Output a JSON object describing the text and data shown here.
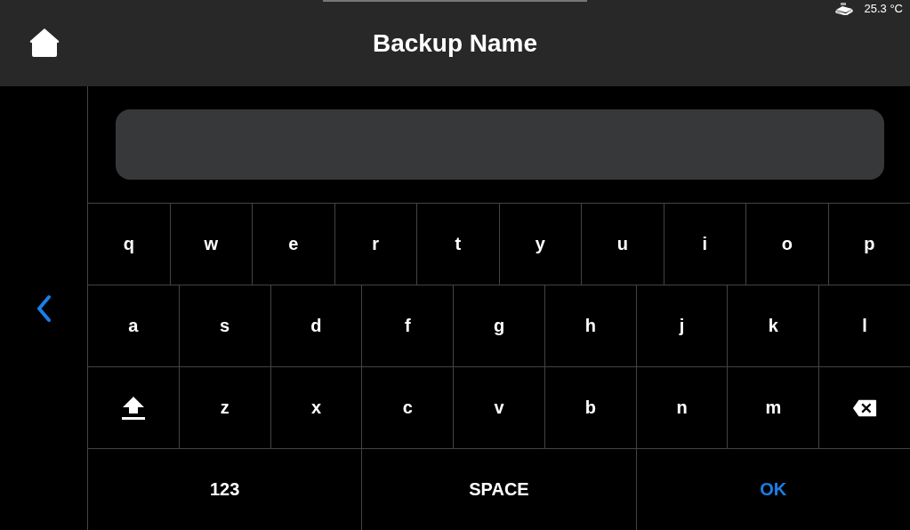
{
  "status_bar": {
    "temperature": "25.3 °C"
  },
  "header": {
    "title": "Backup Name"
  },
  "keyboard": {
    "rows": [
      {
        "keys": [
          {
            "kind": "char",
            "label": "q"
          },
          {
            "kind": "char",
            "label": "w"
          },
          {
            "kind": "char",
            "label": "e"
          },
          {
            "kind": "char",
            "label": "r"
          },
          {
            "kind": "char",
            "label": "t"
          },
          {
            "kind": "char",
            "label": "y"
          },
          {
            "kind": "char",
            "label": "u"
          },
          {
            "kind": "char",
            "label": "i"
          },
          {
            "kind": "char",
            "label": "o"
          },
          {
            "kind": "char",
            "label": "p"
          }
        ]
      },
      {
        "keys": [
          {
            "kind": "char",
            "label": "a"
          },
          {
            "kind": "char",
            "label": "s"
          },
          {
            "kind": "char",
            "label": "d"
          },
          {
            "kind": "char",
            "label": "f"
          },
          {
            "kind": "char",
            "label": "g"
          },
          {
            "kind": "char",
            "label": "h"
          },
          {
            "kind": "char",
            "label": "j"
          },
          {
            "kind": "char",
            "label": "k"
          },
          {
            "kind": "char",
            "label": "l"
          }
        ]
      },
      {
        "keys": [
          {
            "kind": "shift"
          },
          {
            "kind": "char",
            "label": "z"
          },
          {
            "kind": "char",
            "label": "x"
          },
          {
            "kind": "char",
            "label": "c"
          },
          {
            "kind": "char",
            "label": "v"
          },
          {
            "kind": "char",
            "label": "b"
          },
          {
            "kind": "char",
            "label": "n"
          },
          {
            "kind": "char",
            "label": "m"
          },
          {
            "kind": "backspace"
          }
        ]
      },
      {
        "keys": [
          {
            "kind": "mode",
            "label": "123"
          },
          {
            "kind": "space",
            "label": "SPACE"
          },
          {
            "kind": "ok",
            "label": "OK"
          }
        ]
      }
    ]
  }
}
